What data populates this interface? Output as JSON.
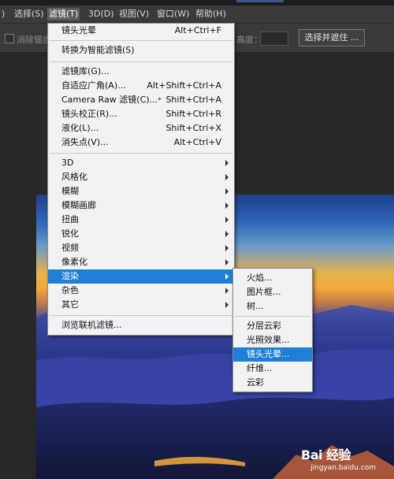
{
  "menubar": {
    "items": [
      {
        "label": ")"
      },
      {
        "label": "选择(S)"
      },
      {
        "label": "滤镜(T)"
      },
      {
        "label": "3D(D)"
      },
      {
        "label": "视图(V)"
      },
      {
        "label": "窗口(W)"
      },
      {
        "label": "帮助(H)"
      }
    ],
    "active_index": 2
  },
  "options_bar": {
    "partial_label": "消除锯齿",
    "height_label": "高度：",
    "select_mask_button": "选择并遮住 ..."
  },
  "filter_menu": {
    "items": [
      {
        "label": "镜头光晕",
        "shortcut": "Alt+Ctrl+F"
      },
      {
        "label": "转换为智能滤镜(S)",
        "shortcut": ""
      },
      {
        "label": "滤镜库(G)...",
        "shortcut": ""
      },
      {
        "label": "自适应广角(A)...",
        "shortcut": "Alt+Shift+Ctrl+A"
      },
      {
        "label": "Camera Raw 滤镜(C)...",
        "shortcut": "Shift+Ctrl+A"
      },
      {
        "label": "镜头校正(R)...",
        "shortcut": "Shift+Ctrl+R"
      },
      {
        "label": "液化(L)...",
        "shortcut": "Shift+Ctrl+X"
      },
      {
        "label": "消失点(V)...",
        "shortcut": "Alt+Ctrl+V"
      },
      {
        "label": "3D",
        "submenu": true
      },
      {
        "label": "风格化",
        "submenu": true
      },
      {
        "label": "模糊",
        "submenu": true
      },
      {
        "label": "模糊画廊",
        "submenu": true
      },
      {
        "label": "扭曲",
        "submenu": true
      },
      {
        "label": "锐化",
        "submenu": true
      },
      {
        "label": "视频",
        "submenu": true
      },
      {
        "label": "像素化",
        "submenu": true
      },
      {
        "label": "渲染",
        "submenu": true,
        "highlighted": true
      },
      {
        "label": "杂色",
        "submenu": true
      },
      {
        "label": "其它",
        "submenu": true
      },
      {
        "label": "浏览联机滤镜...",
        "shortcut": ""
      }
    ]
  },
  "render_submenu": {
    "items": [
      {
        "label": "火焰..."
      },
      {
        "label": "图片框..."
      },
      {
        "label": "树..."
      },
      {
        "label": "分层云彩"
      },
      {
        "label": "光照效果..."
      },
      {
        "label": "镜头光晕...",
        "highlighted": true
      },
      {
        "label": "纤维..."
      },
      {
        "label": "云彩"
      }
    ]
  },
  "watermark": {
    "brand": "Bai 经验",
    "url": "jingyan.baidu.com"
  },
  "colors": {
    "menu_highlight": "#1f7fd6",
    "menubar_bg": "#3a3a3a",
    "workspace_bg": "#282828"
  }
}
